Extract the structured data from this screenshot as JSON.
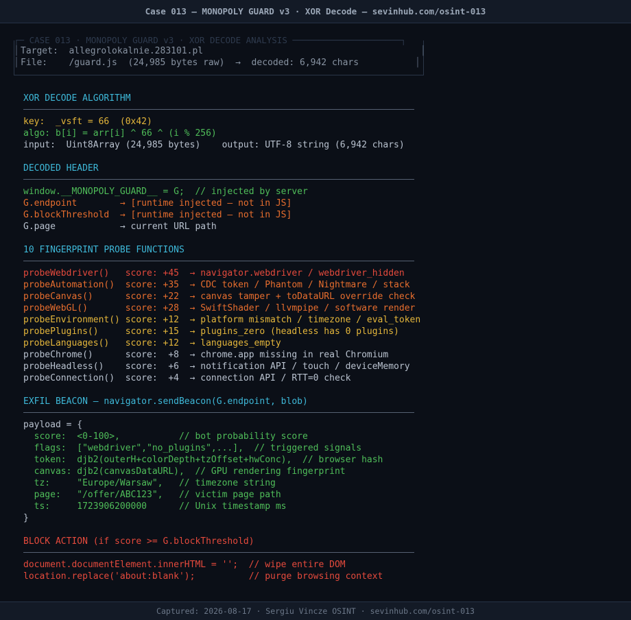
{
  "window": {
    "title": "Case 013 — MONOPOLY GUARD v3 · XOR Decode  —  sevinhub.com/osint-013"
  },
  "info_box": {
    "title": "┌─ CASE 013 · MONOPOLY GUARD v3 · XOR DECODE ANALYSIS ─────────────────────┐",
    "target_line": "Target:  allegrolokalnie.283101.pl",
    "file_line": "File:    /guard.js  (24,985 bytes raw)  →  decoded: 6,942 chars"
  },
  "xor": {
    "heading": "XOR DECODE ALGORITHM",
    "key": "key:  _vsft = 66  (0x42)",
    "algo": "algo: b[i] = arr[i] ^ 66 ^ (i % 256)",
    "io": "input:  Uint8Array (24,985 bytes)    output: UTF-8 string (6,942 chars)"
  },
  "header": {
    "heading": "DECODED HEADER",
    "lines": [
      "window.__MONOPOLY_GUARD__ = G;  // injected by server",
      "G.endpoint        → [runtime injected — not in JS]",
      "G.blockThreshold  → [runtime injected — not in JS]",
      "G.page            → current URL path"
    ]
  },
  "probes": {
    "heading": "10 FINGERPRINT PROBE FUNCTIONS",
    "rows": [
      "probeWebdriver()   score: +45  → navigator.webdriver / webdriver_hidden",
      "probeAutomation()  score: +35  → CDC token / Phantom / Nightmare / stack",
      "probeCanvas()      score: +22  → canvas tamper + toDataURL override check",
      "probeWebGL()       score: +28  → SwiftShader / llvmpipe / software render",
      "probeEnvironment() score: +12  → platform mismatch / timezone / eval_token",
      "probePlugins()     score: +15  → plugins_zero (headless has 0 plugins)",
      "probeLanguages()   score: +12  → languages_empty",
      "probeChrome()      score:  +8  → chrome.app missing in real Chromium",
      "probeHeadless()    score:  +6  → notification API / touch / deviceMemory",
      "probeConnection()  score:  +4  → connection API / RTT=0 check"
    ]
  },
  "beacon": {
    "heading": "EXFIL BEACON — navigator.sendBeacon(G.endpoint, blob)",
    "open": "payload = {",
    "lines": [
      "  score:  <0-100>,           // bot probability score",
      "  flags:  [\"webdriver\",\"no_plugins\",...],  // triggered signals",
      "  token:  djb2(outerH+colorDepth+tzOffset+hwConc),  // browser hash",
      "  canvas: djb2(canvasDataURL),  // GPU rendering fingerprint",
      "  tz:     \"Europe/Warsaw\",   // timezone string",
      "  page:   \"/offer/ABC123\",   // victim page path",
      "  ts:     1723906200000      // Unix timestamp ms"
    ],
    "close": "}"
  },
  "block": {
    "heading": "BLOCK ACTION (if score >= G.blockThreshold)",
    "lines": [
      "document.documentElement.innerHTML = '';  // wipe entire DOM",
      "location.replace('about:blank');          // purge browsing context"
    ]
  },
  "footer": {
    "text": "Captured: 2026-08-17  ·  Sergiu Vincze OSINT  ·  sevinhub.com/osint-013"
  }
}
